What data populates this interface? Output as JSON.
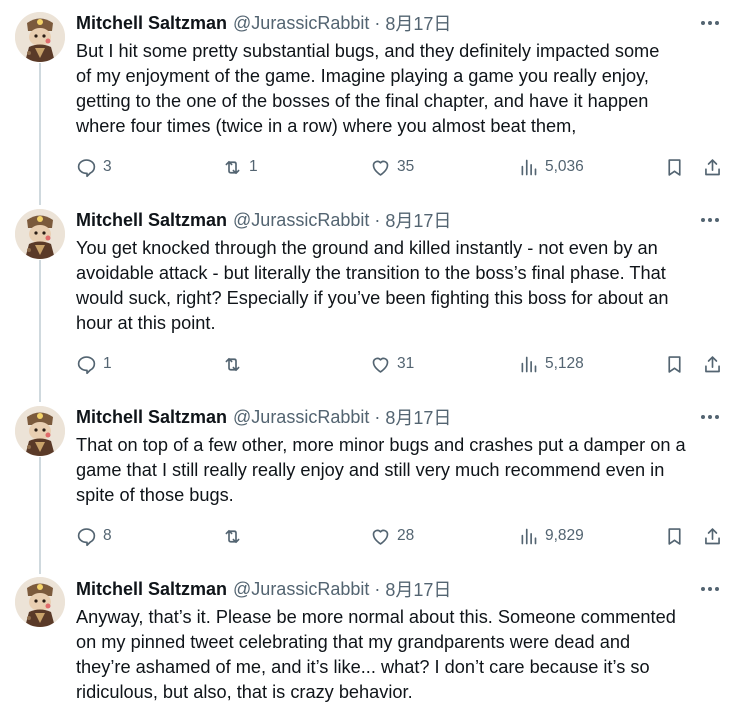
{
  "tweets": [
    {
      "name": "Mitchell Saltzman",
      "handle": "@JurassicRabbit",
      "separator": "·",
      "date": "8月17日",
      "lines": [
        "But I hit some pretty substantial bugs, and they definitely impacted some",
        "of my enjoyment of the game. Imagine playing a game you really enjoy,",
        "getting to the one of the bosses of the final chapter, and have it happen",
        "where four times (twice in a row) where you almost beat them,"
      ],
      "replies": "3",
      "retweets": "1",
      "likes": "35",
      "views": "5,036"
    },
    {
      "name": "Mitchell Saltzman",
      "handle": "@JurassicRabbit",
      "separator": "·",
      "date": "8月17日",
      "lines": [
        "You get knocked through the ground and killed instantly - not even by an",
        "avoidable attack - but literally the transition to the boss’s final phase. That",
        "would suck, right? Especially if you’ve been fighting this boss for about an",
        "hour at this point."
      ],
      "replies": "1",
      "retweets": "",
      "likes": "31",
      "views": "5,128"
    },
    {
      "name": "Mitchell Saltzman",
      "handle": "@JurassicRabbit",
      "separator": "·",
      "date": "8月17日",
      "lines": [
        "That on top of a few other, more minor bugs and crashes put a damper on a",
        "game that I still really really enjoy and still very much recommend even in",
        "spite of those bugs."
      ],
      "replies": "8",
      "retweets": "",
      "likes": "28",
      "views": "9,829"
    },
    {
      "name": "Mitchell Saltzman",
      "handle": "@JurassicRabbit",
      "separator": "·",
      "date": "8月17日",
      "lines": [
        "Anyway, that’s it. Please be more normal about this. Someone commented",
        "on my pinned tweet celebrating that my grandparents were dead and",
        "they’re ashamed of me, and it’s like... what? I don’t care because it’s so",
        "ridiculous, but also, that is crazy behavior."
      ]
    }
  ],
  "icons": {
    "reply": "reply-icon",
    "retweet": "retweet-icon",
    "like": "heart-icon",
    "views": "views-chart-icon",
    "bookmark": "bookmark-icon",
    "share": "share-icon",
    "more": "more-dots-icon"
  },
  "colors": {
    "text": "#0f1419",
    "secondary": "#536471",
    "thread_line": "#cfd9de"
  }
}
